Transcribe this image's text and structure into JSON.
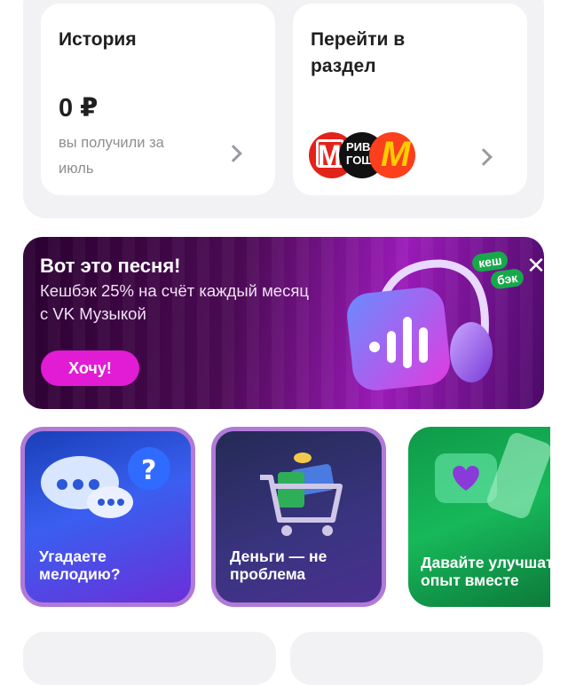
{
  "history_card": {
    "title": "История",
    "amount": "0 ₽",
    "subtitle": "вы получили за июль"
  },
  "section_card": {
    "title": "Перейти в раздел",
    "logo_m": "М",
    "logo_rg": "РИВ ГОШ",
    "logo_ym": "М"
  },
  "promo_banner": {
    "title": "Вот это песня!",
    "text": "Кешбэк 25% на счёт каждый месяц с VK Музыкой",
    "button": "Хочу!",
    "badge_line1": "кеш",
    "badge_line2": "бэк"
  },
  "stories": [
    {
      "label": "Угадаете мелодию?"
    },
    {
      "label": "Деньги — не проблема"
    },
    {
      "label": "Давайте улучшать опыт вместе"
    }
  ],
  "colors": {
    "accent_pink": "#e21bd4",
    "story_ring": "#b07ad6",
    "cashback_green": "#17a84a"
  }
}
